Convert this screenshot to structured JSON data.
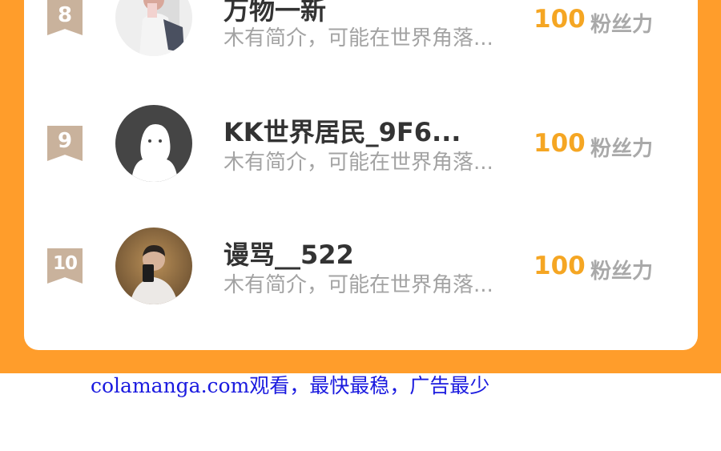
{
  "leaderboard": {
    "rows": [
      {
        "rank": "8",
        "name": "万物一新",
        "bio": "木有简介，可能在世界角落...",
        "score": "100",
        "score_unit": "粉丝力",
        "avatar_icon": "user-photo-avatar"
      },
      {
        "rank": "9",
        "name": "KK世界居民_9F6...",
        "bio": "木有简介，可能在世界角落...",
        "score": "100",
        "score_unit": "粉丝力",
        "avatar_icon": "default-user-avatar"
      },
      {
        "rank": "10",
        "name": "谩骂__522",
        "bio": "木有简介，可能在世界角落...",
        "score": "100",
        "score_unit": "粉丝力",
        "avatar_icon": "user-photo-avatar"
      }
    ]
  },
  "watermark": {
    "text": "colamanga.com观看，最快最稳，广告最少"
  },
  "colors": {
    "background_orange": "#ff9d2b",
    "score": "#f5a623",
    "rank_badge": "#c9b29c",
    "watermark": "#1a1adf"
  }
}
